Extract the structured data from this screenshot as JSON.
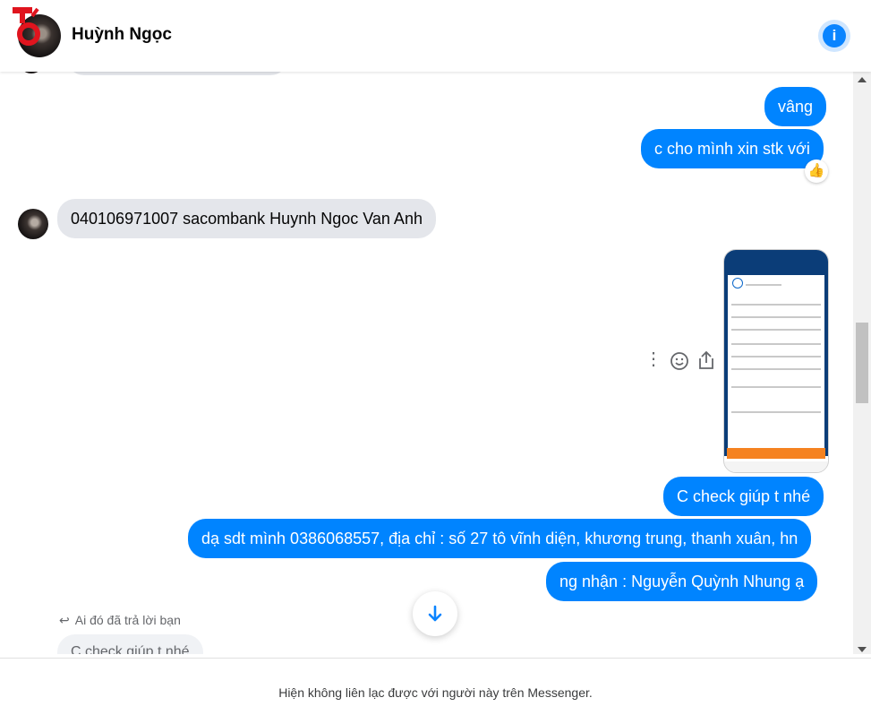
{
  "header": {
    "contact_name": "Huỳnh Ngọc",
    "info_icon": "info-icon"
  },
  "messages": [
    {
      "id": "m1",
      "direction": "outgoing",
      "text": "vâng"
    },
    {
      "id": "m2",
      "direction": "outgoing",
      "text": "c cho mình xin stk với",
      "reaction": "👍"
    },
    {
      "id": "m3",
      "direction": "incoming",
      "text": "040106971007 sacombank Huynh Ngoc Van Anh"
    },
    {
      "id": "m4",
      "direction": "outgoing",
      "type": "image"
    },
    {
      "id": "m5",
      "direction": "outgoing",
      "text": "C check giúp t nhé"
    },
    {
      "id": "m6",
      "direction": "outgoing",
      "text": "dạ sdt mình 0386068557, địa chỉ : số 27 tô vĩnh diện, khương trung, thanh xuân, hn"
    },
    {
      "id": "m7",
      "direction": "outgoing",
      "text": "ng nhận : Nguyễn Quỳnh Nhung ạ"
    }
  ],
  "reply": {
    "label": "Ai đó đã trả lời bạn",
    "quoted_text": "C check giúp t nhé"
  },
  "message_actions": [
    "more-icon",
    "emoji-icon",
    "share-icon"
  ],
  "footer": {
    "notice": "Hiện không liên lạc được với người này trên Messenger."
  },
  "colors": {
    "outgoing_bubble": "#0084ff",
    "incoming_bubble": "#e4e6eb",
    "accent": "#0a84ff"
  }
}
